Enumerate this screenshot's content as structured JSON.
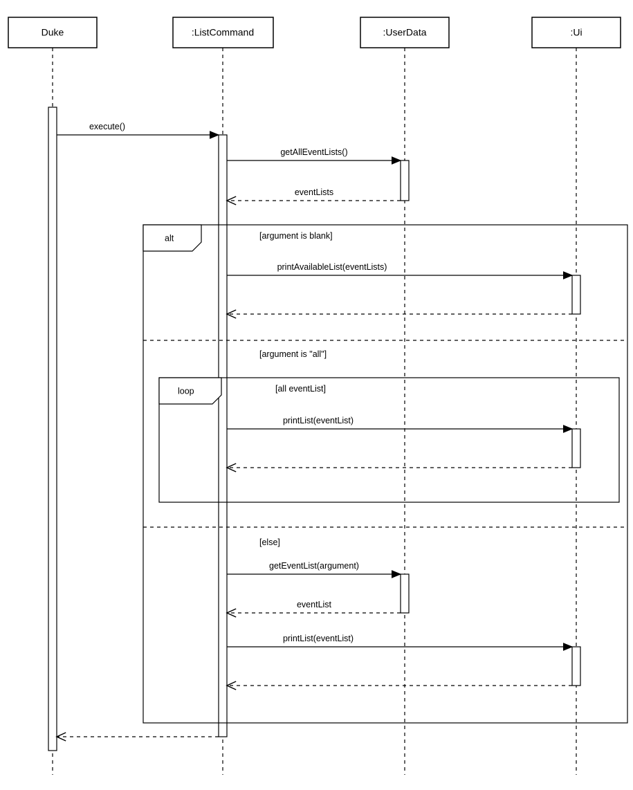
{
  "lifelines": {
    "l0": "Duke",
    "l1": ":ListCommand",
    "l2": ":UserData",
    "l3": ":Ui"
  },
  "messages": {
    "execute": "execute()",
    "getAllEventLists": "getAllEventLists()",
    "eventLists": "eventLists",
    "printAvailableList": "printAvailableList(eventLists)",
    "printList1": "printList(eventList)",
    "getEventList": "getEventList(argument)",
    "eventList": "eventList",
    "printList2": "printList(eventList)"
  },
  "fragments": {
    "alt": "alt",
    "loop": "loop"
  },
  "guards": {
    "blank": "[argument is blank]",
    "all": "[argument is \"all\"]",
    "allEventList": "[all eventList]",
    "else": "[else]"
  }
}
